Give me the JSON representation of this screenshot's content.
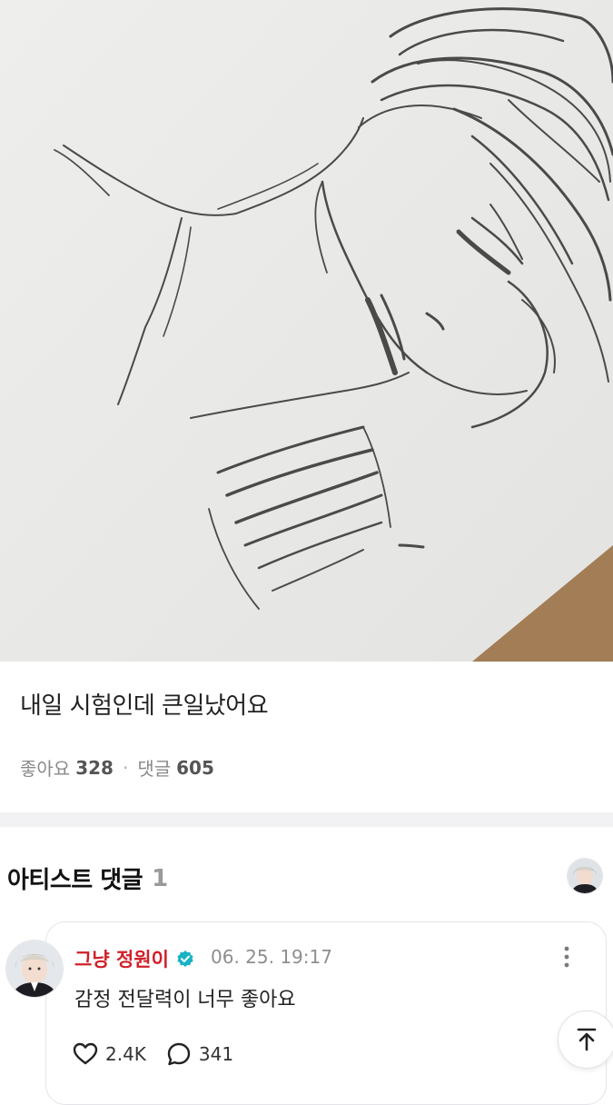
{
  "post": {
    "text": "내일 시험인데 큰일났어요",
    "likes_label": "좋아요",
    "likes_count": "328",
    "separator": "·",
    "comments_label": "댓글",
    "comments_count": "605"
  },
  "artist_comments": {
    "title": "아티스트 댓글",
    "count": "1"
  },
  "comment": {
    "author": "그냥 정원이",
    "time": "06. 25. 19:17",
    "text": "감정 전달력이 너무 좋아요",
    "like_count": "2.4K",
    "reply_count": "341"
  },
  "colors": {
    "author": "#d0202a",
    "badge": "#19b3c4",
    "divider": "#f2f2f4"
  },
  "icons": [
    "verified-badge-icon",
    "more-vertical-icon",
    "heart-icon",
    "comment-bubble-icon",
    "arrow-up-icon"
  ]
}
